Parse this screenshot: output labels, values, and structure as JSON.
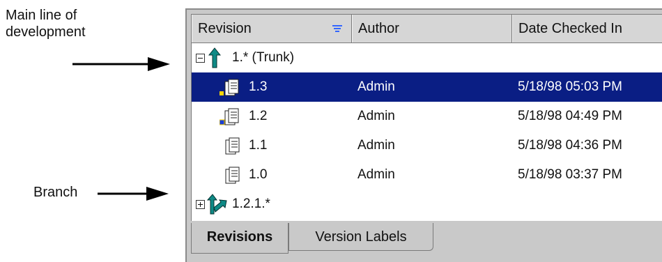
{
  "annotations": {
    "main_line": "Main line of development",
    "branch": "Branch"
  },
  "columns": {
    "revision": "Revision",
    "author": "Author",
    "date": "Date Checked In"
  },
  "tree": {
    "trunk": {
      "label": "1.* (Trunk)",
      "icon": "trunk-arrow-icon"
    },
    "branch": {
      "label": "1.2.1.*",
      "icon": "branch-arrow-icon"
    }
  },
  "revisions": [
    {
      "rev": "1.3",
      "author": "Admin",
      "date": "5/18/98 05:03 PM",
      "selected": true,
      "icon": "document-icon"
    },
    {
      "rev": "1.2",
      "author": "Admin",
      "date": "5/18/98 04:49 PM",
      "selected": false,
      "icon": "document-icon"
    },
    {
      "rev": "1.1",
      "author": "Admin",
      "date": "5/18/98 04:36 PM",
      "selected": false,
      "icon": "document-icon"
    },
    {
      "rev": "1.0",
      "author": "Admin",
      "date": "5/18/98 03:37 PM",
      "selected": false,
      "icon": "document-icon"
    }
  ],
  "tabs": {
    "revisions": "Revisions",
    "version_labels": "Version Labels"
  },
  "colors": {
    "selection": "#0a1e84",
    "trunk_arrow": "#0f8a86",
    "sort_icon": "#3366ff"
  }
}
